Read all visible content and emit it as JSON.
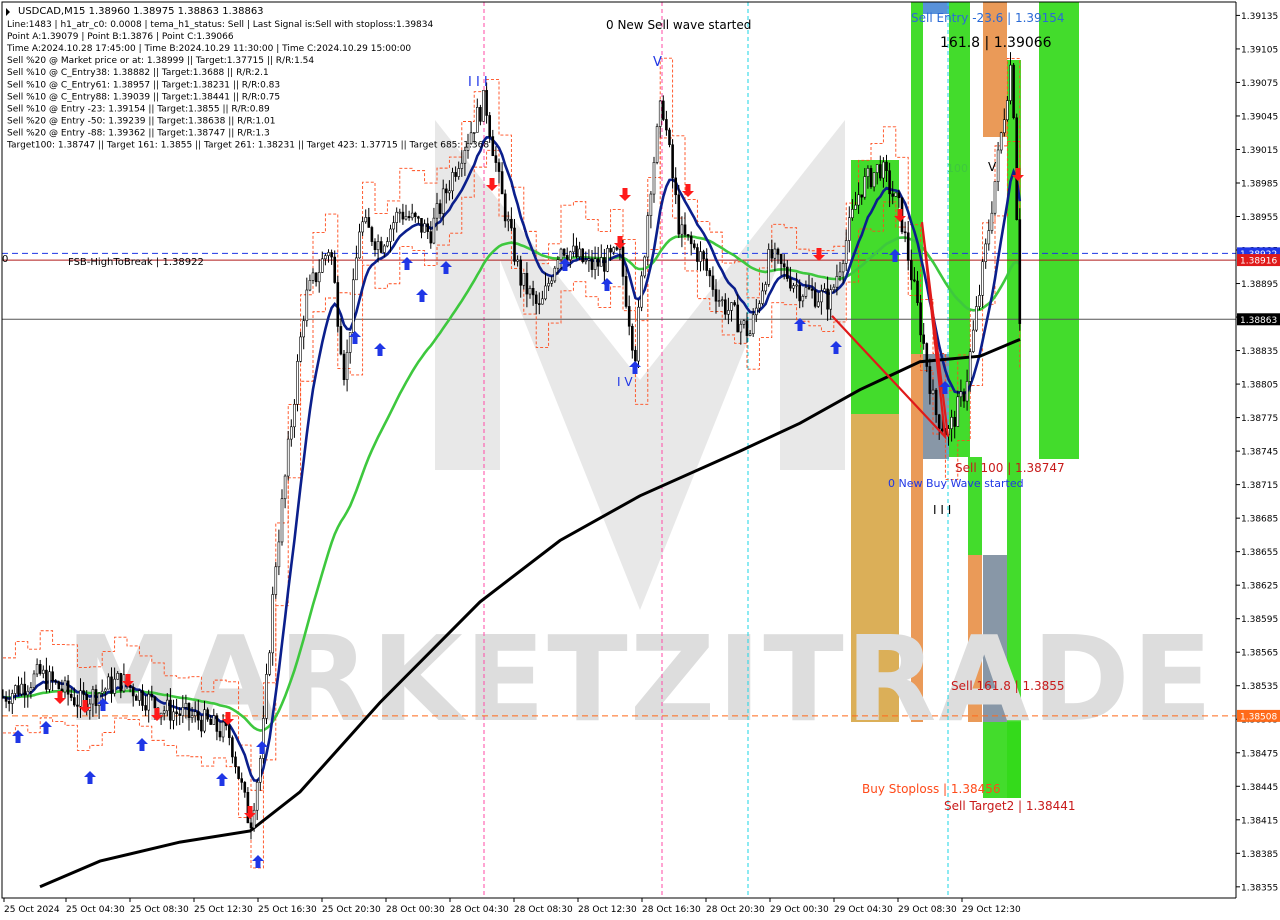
{
  "header": {
    "symbol_line": "USDCAD,M15  1.38960 1.38975 1.38863 1.38863",
    "info_lines": [
      "Line:1483  |  h1_atr_c0: 0.0008  |  tema_h1_status: Sell  |  Last Signal is:Sell with stoploss:1.39834",
      "Point A:1.39079  |  Point B:1.3876  |  Point C:1.39066",
      "Time A:2024.10.28 17:45:00  |  Time B:2024.10.29 11:30:00  |  Time C:2024.10.29 15:00:00",
      "Sell %20 @ Market price or at: 1.38999  ||  Target:1.37715  ||  R/R:1.54",
      "Sell %10 @ C_Entry38: 1.38882  ||  Target:1.3688  ||  R/R:2.1",
      "Sell %10 @ C_Entry61: 1.38957  ||  Target:1.38231  ||  R/R:0.83",
      "Sell %10 @ C_Entry88: 1.39039  ||  Target:1.38441  ||  R/R:0.75",
      "Sell %10 @ Entry -23: 1.39154  ||  Target:1.3855  ||  R/R:0.89",
      "Sell %20 @ Entry -50: 1.39239  ||  Target:1.38638  ||  R/R:1.01",
      "Sell %20 @ Entry -88: 1.39362  ||  Target:1.38747  ||  R/R:1.3",
      "Target100: 1.38747  ||  Target 161: 1.3855  ||  Target 261: 1.38231  ||  Target 423: 1.37715  ||  Target 685: 1.368"
    ]
  },
  "watermark": "MARKETZITRADE",
  "colors": {
    "up": "#000000",
    "down": "#000000",
    "ma_blue": "#0b1f8c",
    "ma_green": "#3ec83e",
    "ma_black": "#000000",
    "envelope": "#ff4a1a",
    "buy_arrow": "#1f36e6",
    "sell_arrow": "#ff1a1a",
    "zone_green": "#33d91a",
    "zone_orange": "#e8914a",
    "zone_tan": "#d8a84a",
    "zone_gray": "#7e8ea0",
    "axis_text": "#000000"
  },
  "chart_data": {
    "type": "candlestick",
    "symbol": "USDCAD",
    "timeframe": "M15",
    "y_ticks": [
      "1.39135",
      "1.39105",
      "1.39075",
      "1.39045",
      "1.39015",
      "1.38985",
      "1.38955",
      "1.38925",
      "1.38895",
      "1.38865",
      "1.38835",
      "1.38805",
      "1.38775",
      "1.38745",
      "1.38715",
      "1.38685",
      "1.38655",
      "1.38625",
      "1.38595",
      "1.38565",
      "1.38535",
      "1.38505",
      "1.38475",
      "1.38445",
      "1.38415",
      "1.38385",
      "1.38355"
    ],
    "ylim": [
      1.38345,
      1.39147
    ],
    "x_ticks": [
      "25 Oct 2024",
      "25 Oct 04:30",
      "25 Oct 08:30",
      "25 Oct 12:30",
      "25 Oct 16:30",
      "25 Oct 20:30",
      "28 Oct 00:30",
      "28 Oct 04:30",
      "28 Oct 08:30",
      "28 Oct 12:30",
      "28 Oct 16:30",
      "28 Oct 20:30",
      "29 Oct 00:30",
      "29 Oct 04:30",
      "29 Oct 08:30",
      "29 Oct 12:30"
    ],
    "price_labels": [
      {
        "text": "1.38922",
        "value": 1.38922,
        "color": "#1f36e6"
      },
      {
        "text": "1.38916",
        "value": 1.38916,
        "color": "#e01a1a"
      },
      {
        "text": "1.38863",
        "value": 1.38863,
        "color": "#000000"
      },
      {
        "text": "1.38508",
        "value": 1.38508,
        "color": "#ff6a1a"
      }
    ],
    "hlines": [
      {
        "value": 1.38922,
        "color": "#1f36e6",
        "dash": true
      },
      {
        "value": 1.38916,
        "color": "#b01a1a",
        "dash": false
      },
      {
        "value": 1.38863,
        "color": "#555555",
        "dash": false
      },
      {
        "value": 1.38508,
        "color": "#ff6a1a",
        "dash": true
      }
    ],
    "annotations": [
      {
        "text": "0 New Sell wave started",
        "color": "#000000"
      },
      {
        "text": "0 New Buy Wave started",
        "color": "#1f36e6"
      },
      {
        "text": "Sell Entry -23.6 | 1.39154",
        "color": "#2a6ad6"
      },
      {
        "text": "161.8 | 1.39066",
        "color": "#000000"
      },
      {
        "text": "100",
        "color": "#3ec83e"
      },
      {
        "text": "Sell 100 | 1.38747",
        "color": "#c81a1a"
      },
      {
        "text": "Sell 161.8 | 1.3855",
        "color": "#c81a1a"
      },
      {
        "text": "Buy Stoploss | 1.38456",
        "color": "#ff4a1a"
      },
      {
        "text": "Sell Target2 | 1.38441",
        "color": "#c81a1a"
      },
      {
        "text": "FSB-HighToBreak  |  1.38922",
        "color": "#000000"
      },
      {
        "text": "0",
        "color": "#000000"
      },
      {
        "text": "I I I",
        "color": "#1f36e6"
      },
      {
        "text": "V",
        "color": "#1f36e6"
      },
      {
        "text": "I V",
        "color": "#1f36e6"
      },
      {
        "text": "I I I",
        "color": "#000000"
      },
      {
        "text": "V",
        "color": "#000000"
      }
    ]
  }
}
